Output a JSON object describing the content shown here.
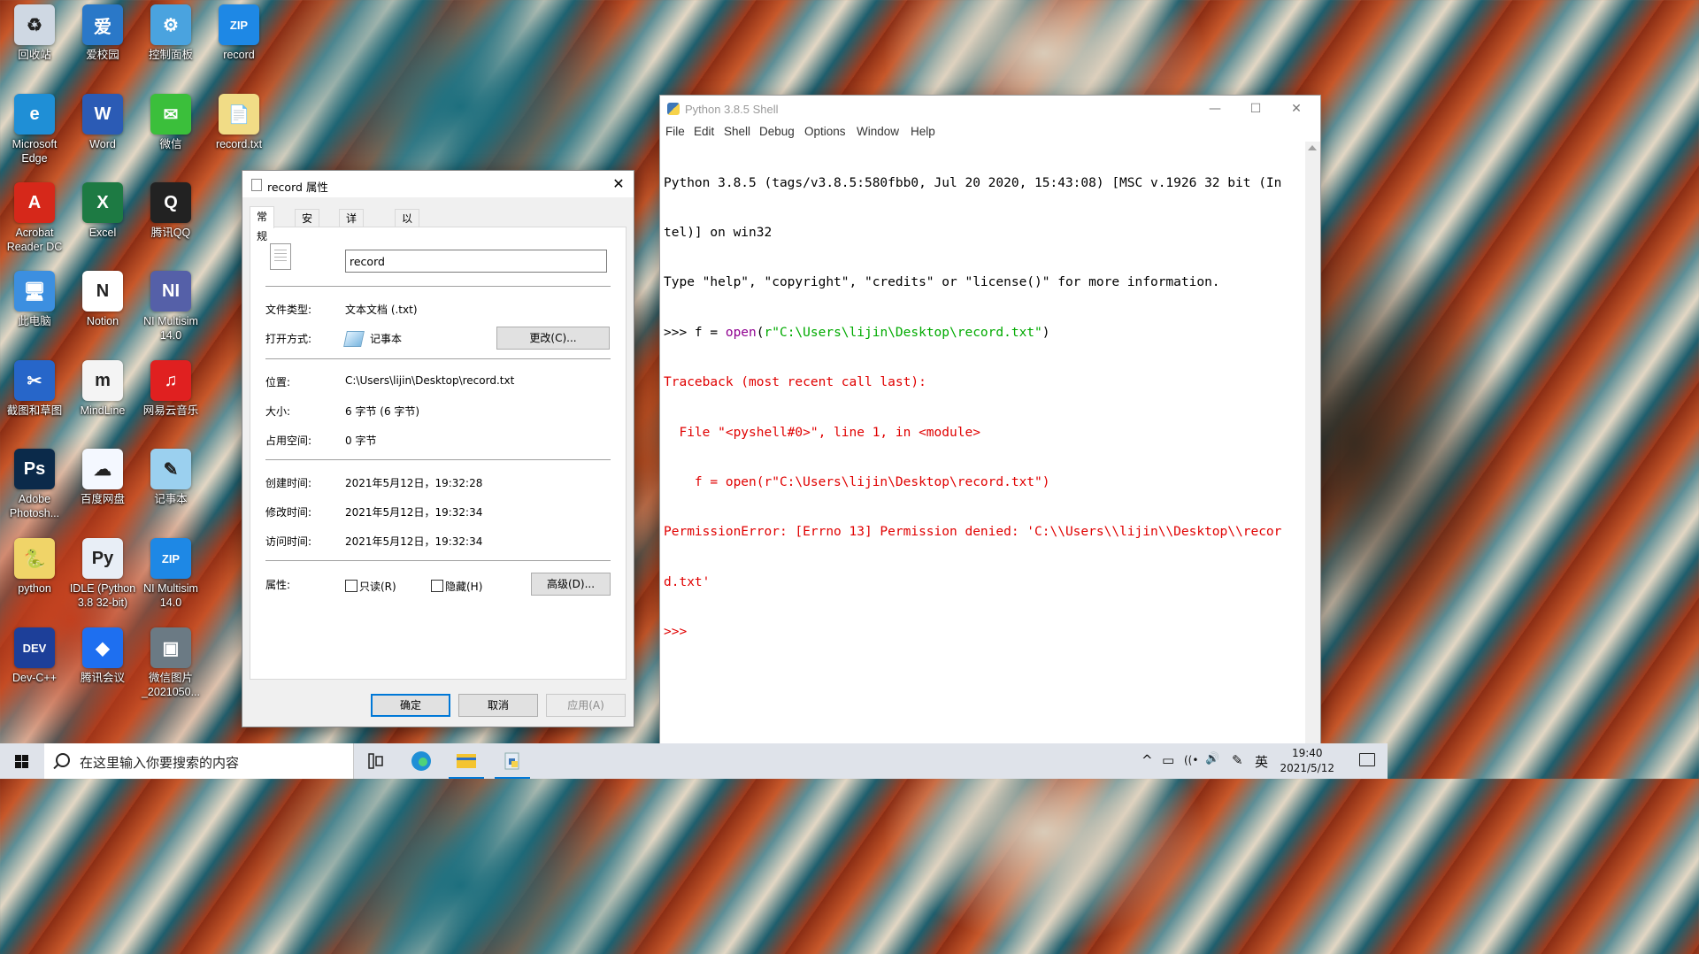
{
  "desktop": {
    "icons": [
      {
        "label": "回收站",
        "glyph": "♻",
        "color": "#cfd8e3"
      },
      {
        "label": "爱校园",
        "glyph": "爱",
        "color": "#2a78c8"
      },
      {
        "label": "控制面板",
        "glyph": "⚙",
        "color": "#4aa3df"
      },
      {
        "label": "record",
        "glyph": "ZIP",
        "color": "#1e88e5"
      },
      {
        "label": "Microsoft Edge",
        "glyph": "e",
        "color": "#1f8fd6"
      },
      {
        "label": "Word",
        "glyph": "W",
        "color": "#2b5bb5"
      },
      {
        "label": "微信",
        "glyph": "✉",
        "color": "#3bbf3b"
      },
      {
        "label": "record.txt",
        "glyph": "📄",
        "color": "#f1dc86"
      },
      {
        "label": "Acrobat Reader DC",
        "glyph": "A",
        "color": "#d6281a"
      },
      {
        "label": "Excel",
        "glyph": "X",
        "color": "#1d7a43"
      },
      {
        "label": "腾讯QQ",
        "glyph": "Q",
        "color": "#222222"
      },
      {
        "label": "此电脑",
        "glyph": "🖥",
        "color": "#3c8fe0"
      },
      {
        "label": "Notion",
        "glyph": "N",
        "color": "#ffffff"
      },
      {
        "label": "NI Multisim 14.0",
        "glyph": "NI",
        "color": "#5560a8"
      },
      {
        "label": "截图和草图",
        "glyph": "✂",
        "color": "#2766c9"
      },
      {
        "label": "MindLine",
        "glyph": "m",
        "color": "#f4f4f4"
      },
      {
        "label": "网易云音乐",
        "glyph": "♫",
        "color": "#e02020"
      },
      {
        "label": "Adobe Photosh...",
        "glyph": "Ps",
        "color": "#0b2a4a"
      },
      {
        "label": "百度网盘",
        "glyph": "☁",
        "color": "#f4f8ff"
      },
      {
        "label": "记事本",
        "glyph": "✎",
        "color": "#9bd0ef"
      },
      {
        "label": "python",
        "glyph": "🐍",
        "color": "#f0d468"
      },
      {
        "label": "IDLE (Python 3.8 32-bit)",
        "glyph": "Py",
        "color": "#e8eef6"
      },
      {
        "label": "NI Multisim 14.0",
        "glyph": "ZIP",
        "color": "#1e88e5"
      },
      {
        "label": "Dev-C++",
        "glyph": "DEV",
        "color": "#1d3f99"
      },
      {
        "label": "腾讯会议",
        "glyph": "◆",
        "color": "#1e6ff0"
      },
      {
        "label": "微信图片_2021050...",
        "glyph": "▣",
        "color": "#6b7a84"
      }
    ]
  },
  "properties_dialog": {
    "title": "record 属性",
    "close": "✕",
    "tabs": [
      "常规",
      "安全",
      "详细信息",
      "以前的版本"
    ],
    "file_name": "record",
    "rows": {
      "file_type_label": "文件类型:",
      "file_type_value": "文本文档 (.txt)",
      "open_with_label": "打开方式:",
      "open_with_value": "记事本",
      "change_button": "更改(C)...",
      "location_label": "位置:",
      "location_value": "C:\\Users\\lijin\\Desktop\\record.txt",
      "size_label": "大小:",
      "size_value": "6 字节 (6 字节)",
      "disk_label": "占用空间:",
      "disk_value": "0 字节",
      "created_label": "创建时间:",
      "created_value": "2021年5月12日，19:32:28",
      "modified_label": "修改时间:",
      "modified_value": "2021年5月12日，19:32:34",
      "accessed_label": "访问时间:",
      "accessed_value": "2021年5月12日，19:32:34",
      "attributes_label": "属性:",
      "readonly_label": "只读(R)",
      "hidden_label": "隐藏(H)",
      "advanced_button": "高级(D)..."
    },
    "buttons": {
      "ok": "确定",
      "cancel": "取消",
      "apply": "应用(A)"
    }
  },
  "python_shell": {
    "title": "Python 3.8.5 Shell",
    "controls": {
      "minimize": "—",
      "maximize": "☐",
      "close": "✕"
    },
    "menu": [
      "File",
      "Edit",
      "Shell",
      "Debug",
      "Options",
      "Window",
      "Help"
    ],
    "lines": [
      {
        "cls": "c-out",
        "text": "Python 3.8.5 (tags/v3.8.5:580fbb0, Jul 20 2020, 15:43:08) [MSC v.1926 32 bit (In"
      },
      {
        "cls": "c-out",
        "text": "tel)] on win32"
      },
      {
        "cls": "c-out",
        "text": "Type \"help\", \"copyright\", \"credits\" or \"license()\" for more information."
      },
      {
        "cls": "c-err",
        "text": "Traceback (most recent call last):"
      },
      {
        "cls": "c-err",
        "text": "  File \"<pyshell#0>\", line 1, in <module>"
      },
      {
        "cls": "c-err",
        "text": "    f = open(r\"C:\\Users\\lijin\\Desktop\\record.txt\")"
      },
      {
        "cls": "c-err",
        "text": "PermissionError: [Errno 13] Permission denied: 'C:\\\\Users\\\\lijin\\\\Desktop\\\\recor"
      },
      {
        "cls": "c-err",
        "text": "d.txt'"
      },
      {
        "cls": "c-err",
        "text": ">>> "
      }
    ],
    "command": {
      "prompt": ">>> ",
      "pre": "f = ",
      "builtin": "open",
      "paren_open": "(",
      "string": "r\"C:\\Users\\lijin\\Desktop\\record.txt\"",
      "paren_close": ")"
    }
  },
  "taskbar": {
    "search_placeholder": "在这里输入你要搜索的内容",
    "tray": {
      "chevron": "^",
      "battery": "▭",
      "wifi": "((•",
      "volume": "🔊",
      "pen": "✎",
      "ime": "英"
    },
    "clock_time": "19:40",
    "clock_date": "2021/5/12"
  }
}
